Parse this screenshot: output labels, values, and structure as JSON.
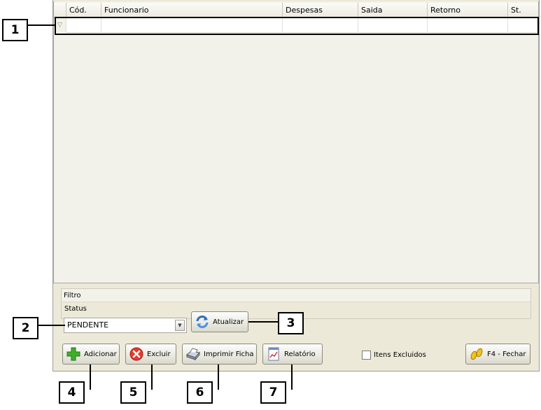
{
  "grid": {
    "columns": [
      "",
      "Cód.",
      "Funcionario",
      "Despesas",
      "Saida",
      "Retorno",
      "St."
    ]
  },
  "filter": {
    "title": "Filtro",
    "status_label": "Status",
    "status_value": "PENDENTE"
  },
  "buttons": {
    "refresh": "Atualizar",
    "add": "Adicionar",
    "delete": "Excluir",
    "print": "Imprimir Ficha",
    "report": "Relatório",
    "close": "F4 - Fechar"
  },
  "checkbox": {
    "label": "Itens Excluidos",
    "checked": false
  },
  "callouts": [
    "1",
    "2",
    "3",
    "4",
    "5",
    "6",
    "7"
  ],
  "icons": {
    "filter": "filter-icon",
    "combo_arrow": "chevron-down-icon",
    "refresh": "refresh-icon",
    "add": "plus-icon",
    "delete": "delete-icon",
    "print": "printer-icon",
    "report": "report-icon",
    "close": "footprints-icon"
  }
}
